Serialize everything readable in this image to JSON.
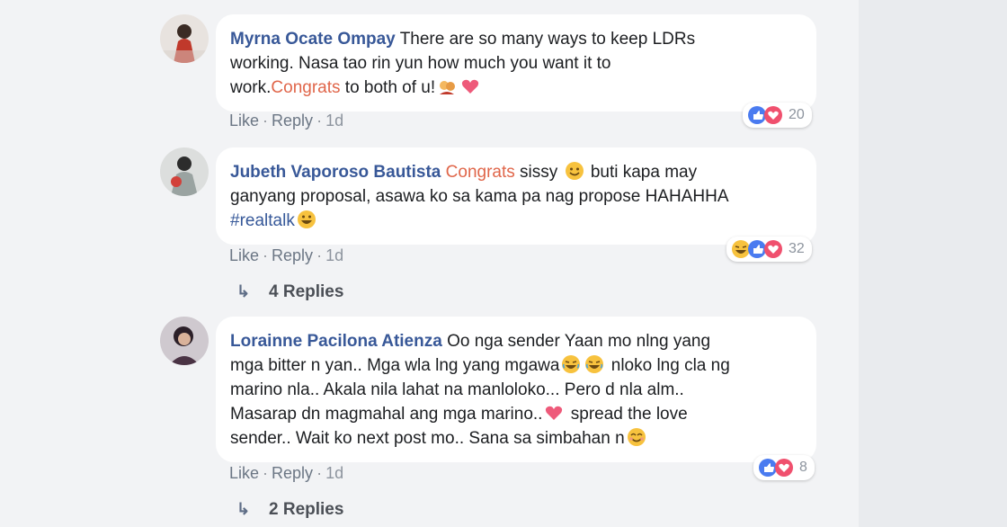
{
  "comments": [
    {
      "author": "Myrna Ocate Ompay",
      "text_lines": [
        "There are so many ways to keep LDRs",
        "working. Nasa tao rin yun how much you want it to",
        "work."
      ],
      "highlight": "Congrats",
      "text_after_highlight": " to both of u!",
      "actions": {
        "like": "Like",
        "reply": "Reply",
        "time": "1d"
      },
      "reactions": {
        "icons": [
          "like-icon",
          "love-icon"
        ],
        "count": "20"
      }
    },
    {
      "author": "Jubeth Vaporoso Bautista",
      "highlight": "Congrats",
      "text_seg1": " sissy ",
      "text_seg2": " buti kapa may",
      "text_line2": "ganyang proposal, asawa ko sa kama pa nag propose HAHAHHA",
      "text_line3": "#realtalk",
      "actions": {
        "like": "Like",
        "reply": "Reply",
        "time": "1d"
      },
      "reactions": {
        "icons": [
          "haha-icon",
          "like-icon",
          "love-icon"
        ],
        "count": "32"
      },
      "replies": "4 Replies"
    },
    {
      "author": "Lorainne Pacilona Atienza",
      "text_line1": "Oo nga sender Yaan mo nlng yang",
      "text_line2a": "mga bitter n yan.. Mga wla lng yang mgawa",
      "text_line2b": " nloko lng cla ng",
      "text_line3": "marino nla.. Akala nila lahat na manloloko... Pero d nla alm..",
      "text_line4a": "Masarap dn magmahal ang mga marino..",
      "text_line4b": " spread the love",
      "text_line5": "sender.. Wait ko next post mo.. Sana sa simbahan n",
      "actions": {
        "like": "Like",
        "reply": "Reply",
        "time": "1d"
      },
      "reactions": {
        "icons": [
          "like-icon",
          "love-icon"
        ],
        "count": "8"
      },
      "replies": "2 Replies"
    }
  ],
  "colors": {
    "author": "#385898",
    "highlight": "#e0664a",
    "like": "#4a7bf0",
    "love": "#f0506e",
    "haha": "#f7c23e"
  }
}
